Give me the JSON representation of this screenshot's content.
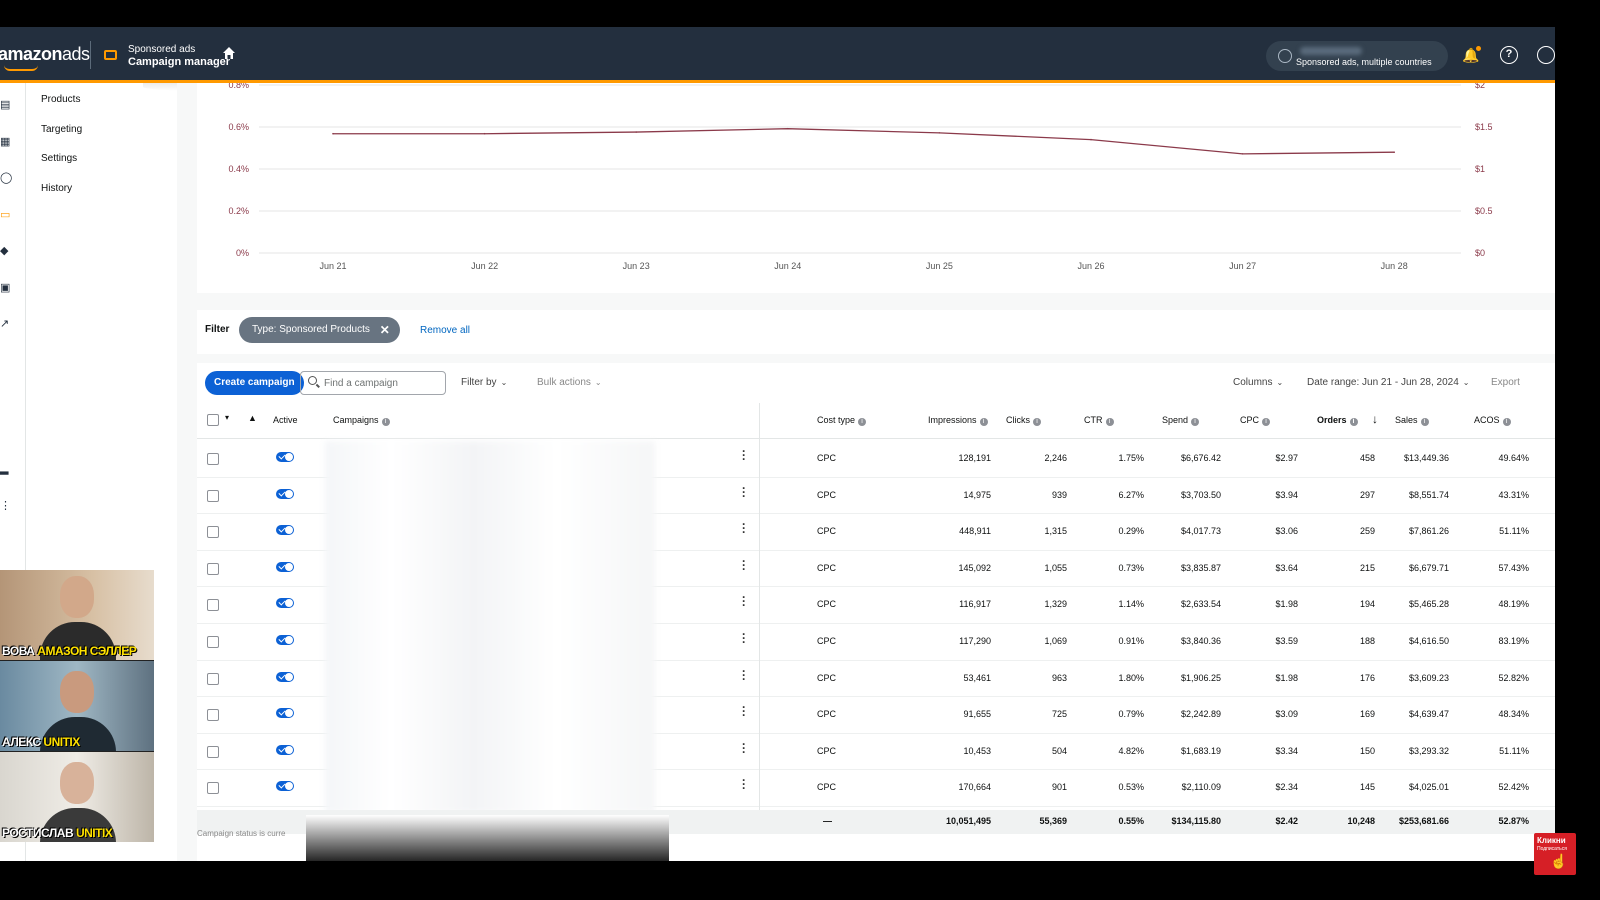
{
  "topbar": {
    "logo_main": "amazon",
    "logo_suffix": "ads",
    "product_name": "Sponsored ads",
    "product_section": "Campaign manager",
    "account_scope": "Sponsored ads, multiple countries"
  },
  "subnav": {
    "items": [
      "Products",
      "Targeting",
      "Settings",
      "History"
    ]
  },
  "chart_data": {
    "type": "line",
    "categories": [
      "Jun 21",
      "Jun 22",
      "Jun 23",
      "Jun 24",
      "Jun 25",
      "Jun 26",
      "Jun 27",
      "Jun 28"
    ],
    "left_axis_ticks": [
      "0%",
      "0.2%",
      "0.4%",
      "0.6%",
      "0.8%"
    ],
    "right_axis_ticks": [
      "$0",
      "$0.5",
      "$1",
      "$1.5",
      "$2"
    ],
    "ylim_left": [
      0,
      0.8
    ],
    "ylim_right": [
      0,
      2
    ],
    "series": [
      {
        "axis": "right",
        "color": "#8b3a4a",
        "values": [
          1.42,
          1.42,
          1.44,
          1.48,
          1.43,
          1.35,
          1.18,
          1.2
        ]
      }
    ],
    "grid": true
  },
  "filter": {
    "label": "Filter",
    "chip": "Type: Sponsored Products",
    "remove_all": "Remove all"
  },
  "toolbar": {
    "create_campaign": "Create campaign",
    "search_placeholder": "Find a campaign",
    "filter_by": "Filter by",
    "bulk_actions": "Bulk actions",
    "columns": "Columns",
    "date_range": "Date range: Jun 21 - Jun 28, 2024",
    "export": "Export"
  },
  "table": {
    "headers": {
      "active": "Active",
      "campaigns": "Campaigns",
      "cost_type": "Cost type",
      "impressions": "Impressions",
      "clicks": "Clicks",
      "ctr": "CTR",
      "spend": "Spend",
      "cpc": "CPC",
      "orders": "Orders",
      "sales": "Sales",
      "acos": "ACOS"
    },
    "rows": [
      {
        "cost_type": "CPC",
        "impressions": "128,191",
        "clicks": "2,246",
        "ctr": "1.75%",
        "spend": "$6,676.42",
        "cpc": "$2.97",
        "orders": "458",
        "sales": "$13,449.36",
        "acos": "49.64%"
      },
      {
        "cost_type": "CPC",
        "impressions": "14,975",
        "clicks": "939",
        "ctr": "6.27%",
        "spend": "$3,703.50",
        "cpc": "$3.94",
        "orders": "297",
        "sales": "$8,551.74",
        "acos": "43.31%"
      },
      {
        "cost_type": "CPC",
        "impressions": "448,911",
        "clicks": "1,315",
        "ctr": "0.29%",
        "spend": "$4,017.73",
        "cpc": "$3.06",
        "orders": "259",
        "sales": "$7,861.26",
        "acos": "51.11%"
      },
      {
        "cost_type": "CPC",
        "impressions": "145,092",
        "clicks": "1,055",
        "ctr": "0.73%",
        "spend": "$3,835.87",
        "cpc": "$3.64",
        "orders": "215",
        "sales": "$6,679.71",
        "acos": "57.43%"
      },
      {
        "cost_type": "CPC",
        "impressions": "116,917",
        "clicks": "1,329",
        "ctr": "1.14%",
        "spend": "$2,633.54",
        "cpc": "$1.98",
        "orders": "194",
        "sales": "$5,465.28",
        "acos": "48.19%"
      },
      {
        "cost_type": "CPC",
        "impressions": "117,290",
        "clicks": "1,069",
        "ctr": "0.91%",
        "spend": "$3,840.36",
        "cpc": "$3.59",
        "orders": "188",
        "sales": "$4,616.50",
        "acos": "83.19%"
      },
      {
        "cost_type": "CPC",
        "impressions": "53,461",
        "clicks": "963",
        "ctr": "1.80%",
        "spend": "$1,906.25",
        "cpc": "$1.98",
        "orders": "176",
        "sales": "$3,609.23",
        "acos": "52.82%"
      },
      {
        "cost_type": "CPC",
        "impressions": "91,655",
        "clicks": "725",
        "ctr": "0.79%",
        "spend": "$2,242.89",
        "cpc": "$3.09",
        "orders": "169",
        "sales": "$4,639.47",
        "acos": "48.34%"
      },
      {
        "cost_type": "CPC",
        "impressions": "10,453",
        "clicks": "504",
        "ctr": "4.82%",
        "spend": "$1,683.19",
        "cpc": "$3.34",
        "orders": "150",
        "sales": "$3,293.32",
        "acos": "51.11%"
      },
      {
        "cost_type": "CPC",
        "impressions": "170,664",
        "clicks": "901",
        "ctr": "0.53%",
        "spend": "$2,110.09",
        "cpc": "$2.34",
        "orders": "145",
        "sales": "$4,025.01",
        "acos": "52.42%"
      }
    ],
    "totals": {
      "cost_type": "—",
      "impressions": "10,051,495",
      "clicks": "55,369",
      "ctr": "0.55%",
      "spend": "$134,115.80",
      "cpc": "$2.42",
      "orders": "10,248",
      "sales": "$253,681.66",
      "acos": "52.87%"
    }
  },
  "footnote": "Campaign status is curre",
  "cams": [
    {
      "first": "ВОВА ",
      "second": "АМАЗОН СЭЛЛЕР"
    },
    {
      "first": "АЛЕКС ",
      "second": "UNITIX"
    },
    {
      "first": "РОСТИСЛАВ ",
      "second": "UNITIX"
    }
  ],
  "subscribe": {
    "line1": "Кликни",
    "line2": "Подписаться"
  }
}
